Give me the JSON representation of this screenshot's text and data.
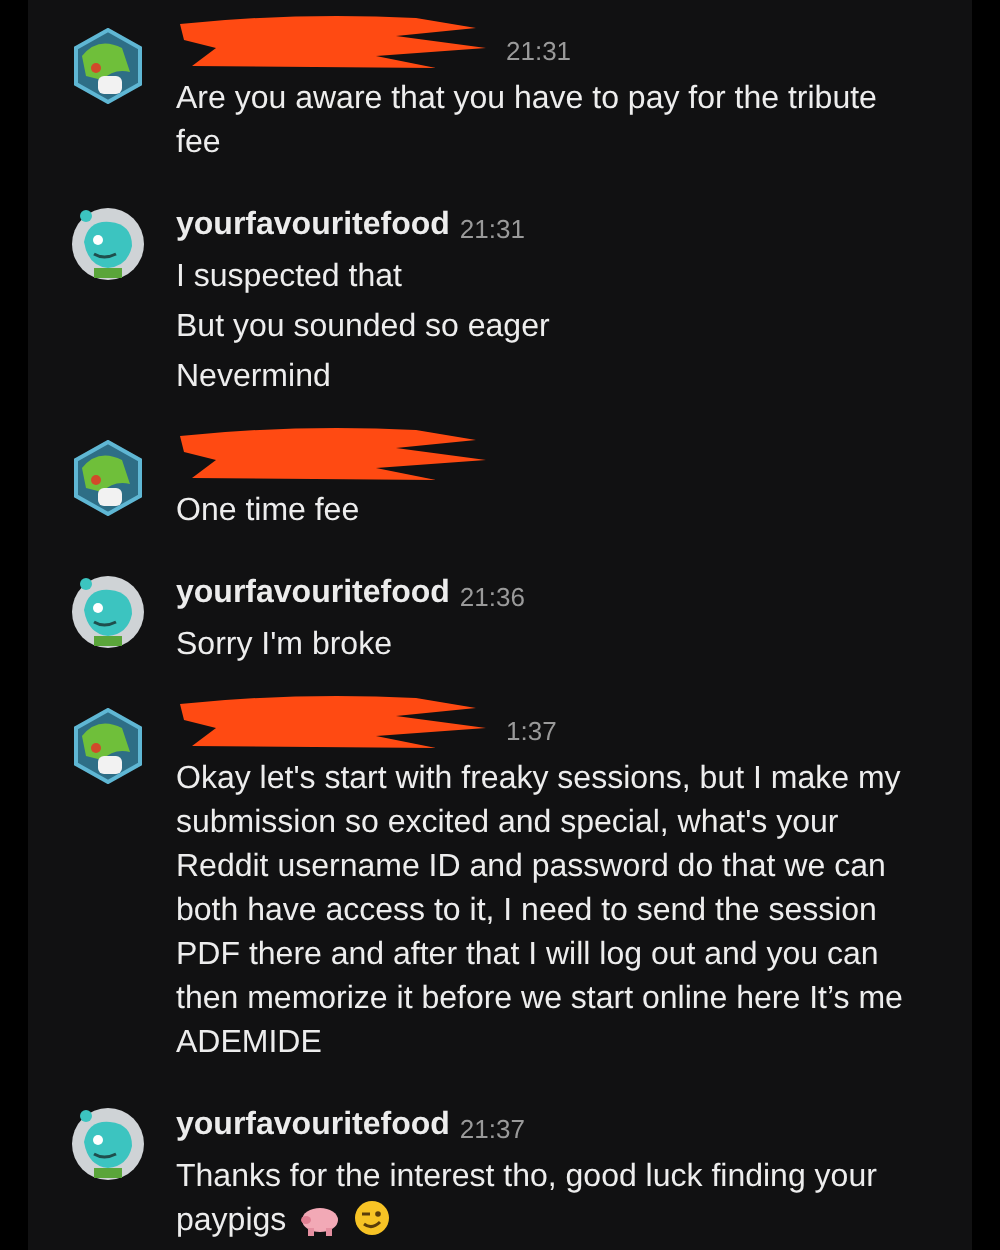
{
  "groups": [
    {
      "author_redacted": true,
      "avatar": {
        "kind": "hexagon"
      },
      "time": "21:31",
      "messages": [
        "Are you aware that you have to pay for the tribute fee"
      ]
    },
    {
      "author_redacted": false,
      "avatar": {
        "kind": "round"
      },
      "author": "yourfavouritefood",
      "time": "21:31",
      "messages": [
        "I suspected that",
        "But you sounded so eager",
        "Nevermind"
      ]
    },
    {
      "author_redacted": true,
      "avatar": {
        "kind": "hexagon"
      },
      "messages": [
        "One time fee"
      ]
    },
    {
      "author_redacted": false,
      "avatar": {
        "kind": "round"
      },
      "author": "yourfavouritefood",
      "time": "21:36",
      "messages": [
        "Sorry I'm broke"
      ]
    },
    {
      "author_redacted": true,
      "avatar": {
        "kind": "hexagon"
      },
      "time": "1:37",
      "messages": [
        "Okay let's start with freaky sessions, but I make my submission so excited and special, what's your Reddit username ID and password do that we can both have access to it, I need to send the session PDF there and after that I will log out and you can then memorize it before we start online here It’s me ADEMIDE"
      ]
    },
    {
      "author_redacted": false,
      "avatar": {
        "kind": "round"
      },
      "author": "yourfavouritefood",
      "time": "21:37",
      "messages": [
        "Thanks for the interest tho, good luck finding your paypigs"
      ],
      "trailing_icons": [
        {
          "kind": "pig"
        },
        {
          "kind": "wink"
        }
      ]
    }
  ]
}
